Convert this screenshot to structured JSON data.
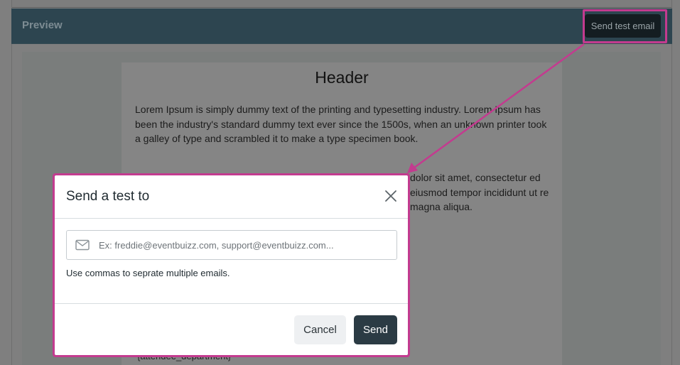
{
  "preview": {
    "title": "Preview",
    "send_test_label": "Send test email"
  },
  "email": {
    "header": "Header",
    "paragraph1": "Lorem Ipsum is simply dummy text of the printing and typesetting industry. Lorem Ipsum has been the industry's standard dummy text ever since the 1500s, when an unknown printer took a galley of type and scrambled it to make a type specimen book.",
    "paragraph2": "dolor sit amet, consectetur ed eiusmod tempor incididunt ut re magna aliqua.",
    "footer_token": "{attendee_department}"
  },
  "modal": {
    "title": "Send a test to",
    "email_placeholder": "Ex: freddie@eventbuizz.com, support@eventbuizz.com...",
    "email_value": "",
    "hint": "Use commas to seprate multiple emails.",
    "cancel_label": "Cancel",
    "send_label": "Send"
  },
  "colors": {
    "annotation": "#c33b8f",
    "primary_button": "#2b3b44",
    "header_bar": "#2d4550"
  },
  "icons": {
    "close": "close-icon",
    "mail": "mail-icon"
  }
}
